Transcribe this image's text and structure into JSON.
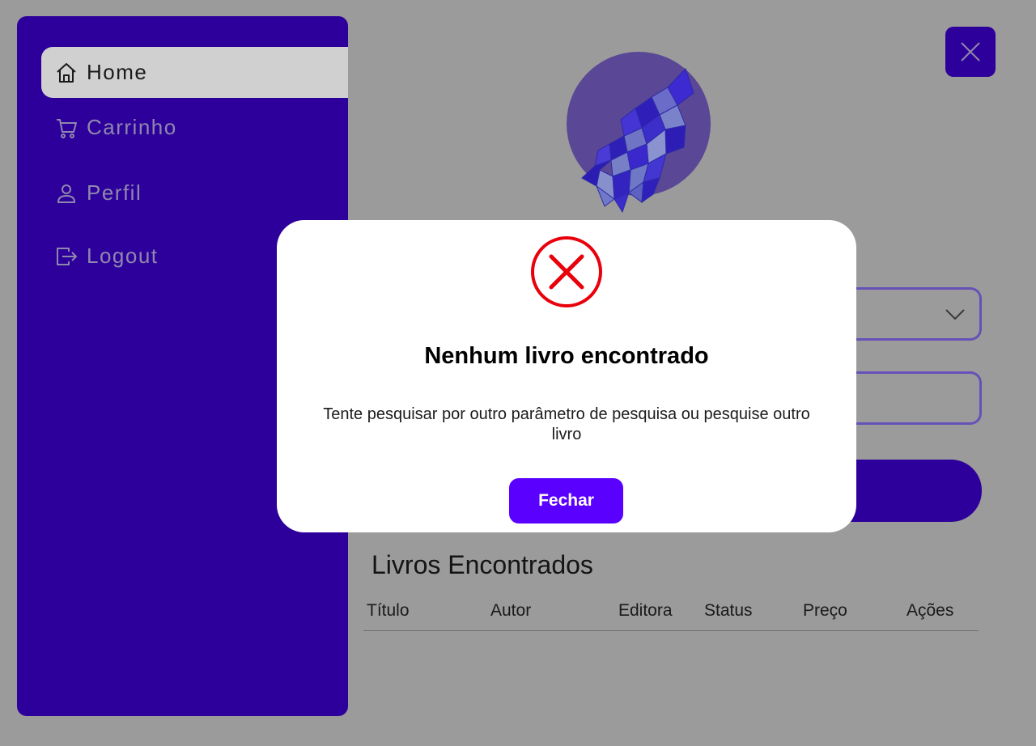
{
  "sidebar": {
    "items": [
      {
        "label": "Home",
        "icon": "home-icon",
        "active": true
      },
      {
        "label": "Carrinho",
        "icon": "cart-icon",
        "active": false
      },
      {
        "label": "Perfil",
        "icon": "user-icon",
        "active": false
      },
      {
        "label": "Logout",
        "icon": "logout-icon",
        "active": false
      }
    ]
  },
  "header": {
    "close_icon": "close-icon"
  },
  "results": {
    "title": "Livros Encontrados",
    "columns": [
      "Título",
      "Autor",
      "Editora",
      "Status",
      "Preço",
      "Ações"
    ]
  },
  "modal": {
    "icon": "error-icon",
    "title": "Nenhum livro encontrado",
    "message": "Tente pesquisar por outro parâmetro de pesquisa ou pesquise outro livro",
    "button_label": "Fechar"
  },
  "colors": {
    "primary": "#2e009b",
    "accent": "#5a00ff",
    "error": "#e8000b",
    "overlay": "#9b9b9b",
    "input_border": "#6651b8"
  }
}
